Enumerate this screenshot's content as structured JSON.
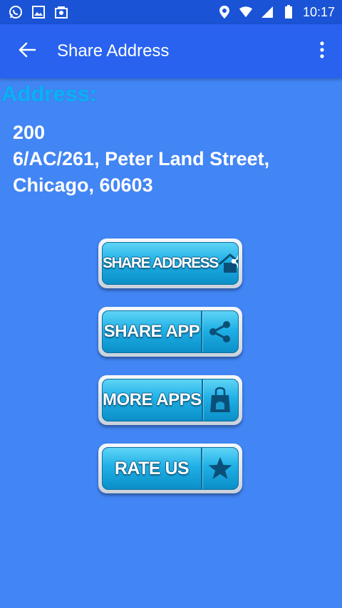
{
  "status_bar": {
    "time": "10:17",
    "left_icons": [
      "whatsapp-icon",
      "image-icon",
      "photo-library-icon"
    ],
    "right_icons": [
      "location-icon",
      "wifi-icon",
      "signal-icon",
      "battery-icon"
    ]
  },
  "app_bar": {
    "title": "Share Address",
    "back_icon": "arrow-back-icon",
    "menu_icon": "more-vert-icon",
    "color": "#2962ef"
  },
  "address": {
    "label": "Address:",
    "lines": [
      "200",
      "6/AC/261, Peter Land Street,",
      "Chicago, 60603"
    ]
  },
  "buttons": [
    {
      "label": "SHARE ADDRESS",
      "icon": "home-share-icon"
    },
    {
      "label": "SHARE APP",
      "icon": "share-icon"
    },
    {
      "label": "MORE APPS",
      "icon": "shopping-bag-icon"
    },
    {
      "label": "RATE US",
      "icon": "star-icon"
    }
  ],
  "colors": {
    "background": "#4285f4",
    "status_bar": "#1a53d6",
    "address_label": "#0bb0f5",
    "button_face": "#1fb0e6",
    "icon_dark": "#0b4f78"
  }
}
